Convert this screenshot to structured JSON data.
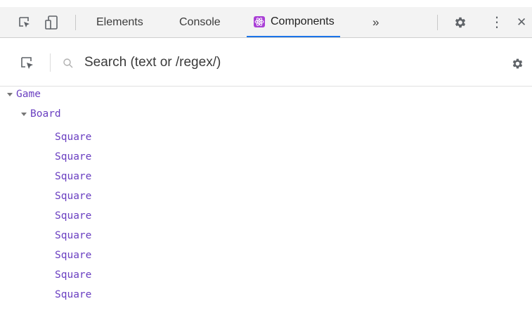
{
  "toolbar": {
    "tabs": [
      {
        "label": "Elements"
      },
      {
        "label": "Console"
      },
      {
        "label": "Components"
      }
    ],
    "overflow_label": "»",
    "more_label": "⋮",
    "close_label": "✕"
  },
  "search": {
    "placeholder": "Search (text or /regex/)"
  },
  "tree": {
    "root": {
      "label": "Game"
    },
    "child": {
      "label": "Board"
    },
    "leaves": [
      {
        "label": "Square"
      },
      {
        "label": "Square"
      },
      {
        "label": "Square"
      },
      {
        "label": "Square"
      },
      {
        "label": "Square"
      },
      {
        "label": "Square"
      },
      {
        "label": "Square"
      },
      {
        "label": "Square"
      },
      {
        "label": "Square"
      }
    ]
  },
  "colors": {
    "accent": "#1a73e8",
    "component_name": "#6a3fc1",
    "react_badge": "#a93fd6"
  }
}
